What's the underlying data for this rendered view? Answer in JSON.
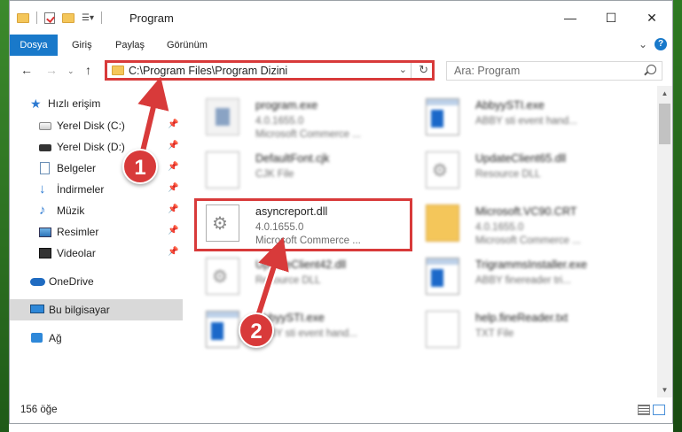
{
  "window": {
    "title": "Program",
    "controls": {
      "minimize": "—",
      "maximize": "☐",
      "close": "✕"
    }
  },
  "ribbon": {
    "tabs": [
      "Dosya",
      "Giriş",
      "Paylaş",
      "Görünüm"
    ]
  },
  "address": {
    "path": "C:\\Program Files\\Program Dizini",
    "search_placeholder": "Ara: Program"
  },
  "sidebar": {
    "quick_access": "Hızlı erişim",
    "items": [
      "Yerel Disk (C:)",
      "Yerel Disk (D:)",
      "Belgeler",
      "İndirmeler",
      "Müzik",
      "Resimler",
      "Videolar"
    ],
    "onedrive": "OneDrive",
    "this_pc": "Bu bilgisayar",
    "network": "Ağ"
  },
  "files": [
    {
      "name": "program.exe",
      "line2": "4.0.1655.0",
      "line3": "Microsoft Commerce ...",
      "icon": "exe-icon"
    },
    {
      "name": "AbbyySTI.exe",
      "line2": "ABBY sti event hand...",
      "line3": "",
      "icon": "app-icon"
    },
    {
      "name": "DefaultFont.cjk",
      "line2": "CJK File",
      "line3": "",
      "icon": "page-icon"
    },
    {
      "name": "UpdateClient65.dll",
      "line2": "Resource DLL",
      "line3": "",
      "icon": "dll-icon"
    },
    {
      "name": "asyncreport.dll",
      "line2": "4.0.1655.0",
      "line3": "Microsoft Commerce ...",
      "icon": "dll-icon"
    },
    {
      "name": "Microsoft.VC90.CRT",
      "line2": "4.0.1655.0",
      "line3": "Microsoft Commerce ...",
      "icon": "folder-icon"
    },
    {
      "name": "UpdateClient42.dll",
      "line2": "Resource DLL",
      "line3": "",
      "icon": "dll-icon"
    },
    {
      "name": "TrigrammsInstaller.exe",
      "line2": "ABBY finereader tri...",
      "line3": "",
      "icon": "app-icon"
    },
    {
      "name": "AbbyySTI.exe",
      "line2": "ABBY sti event hand...",
      "line3": "",
      "icon": "app-icon"
    },
    {
      "name": "help.fineReader.txt",
      "line2": "TXT File",
      "line3": "",
      "icon": "page-icon"
    }
  ],
  "status": {
    "count": "156 öğe"
  },
  "callouts": [
    "1",
    "2"
  ],
  "colors": {
    "accent": "#1979ca",
    "highlight": "#d83a3a"
  }
}
